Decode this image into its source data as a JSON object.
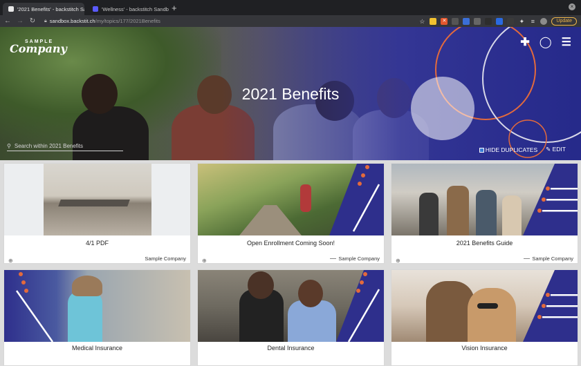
{
  "browser": {
    "tabs": [
      {
        "title": "'2021 Benefits' - backstitch Sa",
        "active": true
      },
      {
        "title": "'Wellness' - backstitch Sandb",
        "active": false
      }
    ],
    "new_tab": "+",
    "url_host": "sandbox.backstit.ch",
    "url_path": "/my/topics/177/2021Benefits",
    "update_label": "Update"
  },
  "hero": {
    "logo_top": "SAMPLE",
    "logo_bottom": "Company",
    "title": "2021 Benefits",
    "search_placeholder": "Search within 2021 Benefits",
    "hide_duplicates_label": "HIDE DUPLICATES",
    "edit_label": "EDIT",
    "colors": {
      "brand": "#2e2f8c",
      "accent": "#e36a3c"
    }
  },
  "cards": [
    {
      "title": "4/1 PDF",
      "source": "Sample Company",
      "has_dash": false
    },
    {
      "title": "Open Enrollment Coming Soon!",
      "source": "Sample Company",
      "has_dash": true
    },
    {
      "title": "2021 Benefits Guide",
      "source": "Sample Company",
      "has_dash": true
    },
    {
      "title": "Medical Insurance"
    },
    {
      "title": "Dental Insurance"
    },
    {
      "title": "Vision Insurance"
    }
  ]
}
